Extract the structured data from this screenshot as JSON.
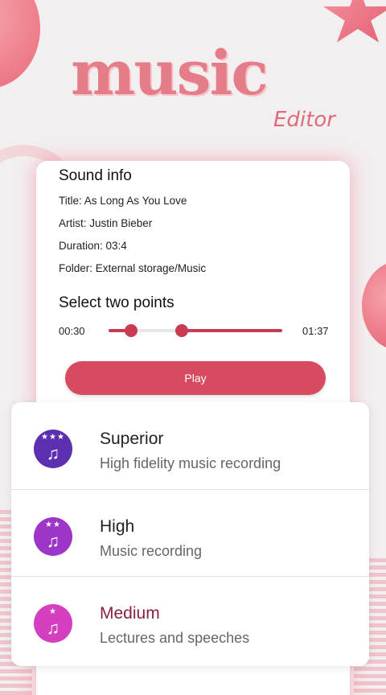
{
  "logo": {
    "word": "music",
    "sub": "Editor"
  },
  "sound_info": {
    "heading": "Sound info",
    "title": "Title: As Long As You Love",
    "artist": "Artist: Justin Bieber",
    "duration": "Duration: 03:4",
    "folder": "Folder: External storage/Music"
  },
  "selection": {
    "heading": "Select two points",
    "start_time": "00:30",
    "end_time": "01:37",
    "point_a_fraction": 0.13,
    "point_b_fraction": 0.42
  },
  "play_label": "Play",
  "quality_options": [
    {
      "title": "Superior",
      "subtitle": "High fidelity music recording",
      "stars": 3,
      "icon": "music-note-icon",
      "color": "#5b2fb0",
      "title_color": "#222222"
    },
    {
      "title": "High",
      "subtitle": "Music recording",
      "stars": 2,
      "icon": "music-note-icon",
      "color": "#9c35c8",
      "title_color": "#222222"
    },
    {
      "title": "Medium",
      "subtitle": "Lectures and speeches",
      "stars": 1,
      "icon": "music-note-icon",
      "color": "#d43fbf",
      "title_color": "#8a2040"
    }
  ],
  "colors": {
    "accent": "#d84a5f",
    "slider": "#c83b52"
  }
}
